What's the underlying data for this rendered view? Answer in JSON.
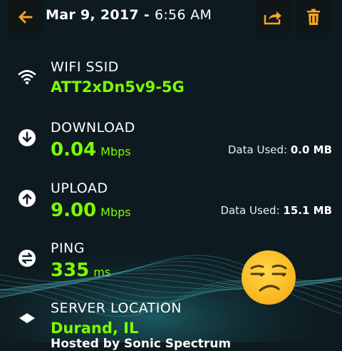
{
  "header": {
    "date": "Mar 9, 2017",
    "separator": " - ",
    "time": "6:56 AM",
    "accent_color": "#f5a623",
    "icons": [
      "back-arrow-icon",
      "share-icon",
      "trash-icon"
    ]
  },
  "wifi": {
    "label": "WIFI SSID",
    "value": "ATT2xDn5v9-5G",
    "icon": "wifi-icon"
  },
  "download": {
    "label": "DOWNLOAD",
    "value": "0.04",
    "unit": "Mbps",
    "data_used_label": "Data Used:",
    "data_used_value": "0.0 MB",
    "icon": "download-arrow-icon"
  },
  "upload": {
    "label": "UPLOAD",
    "value": "9.00",
    "unit": "Mbps",
    "data_used_label": "Data Used:",
    "data_used_value": "15.1 MB",
    "icon": "upload-arrow-icon"
  },
  "ping": {
    "label": "PING",
    "value": "335",
    "unit": "ms",
    "icon": "ping-icon",
    "rating_icon": "unamused-face-emoji"
  },
  "server": {
    "label": "SERVER LOCATION",
    "value": "Durand, IL",
    "hosted_by": "Hosted by Sonic Spectrum",
    "icon": "server-location-icon"
  },
  "colors": {
    "value_green": "#7cfc00",
    "background": "#0d1a1f"
  }
}
